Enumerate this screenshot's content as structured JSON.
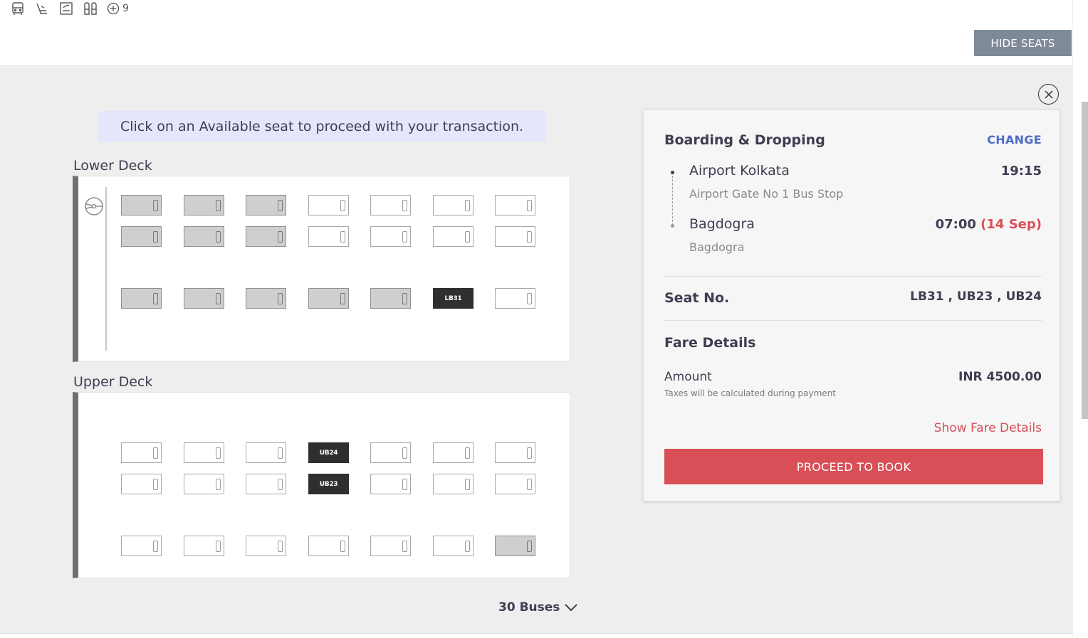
{
  "amenities": {
    "icons": [
      "bus-icon",
      "reclining-seat-icon",
      "charging-point-icon",
      "blanket-icon"
    ],
    "more_count": "9"
  },
  "hide_seats_label": "HIDE SEATS",
  "notice": "Click on an Available seat to proceed with your transaction.",
  "lower_deck": {
    "label": "Lower Deck",
    "selected_seat": "LB31"
  },
  "upper_deck": {
    "label": "Upper Deck",
    "selected_seats": [
      "UB24",
      "UB23"
    ]
  },
  "buses_count": "30 Buses",
  "summary": {
    "boarding_title": "Boarding & Dropping",
    "change_label": "CHANGE",
    "boarding": {
      "name": "Airport Kolkata",
      "sub": "Airport Gate No 1 Bus Stop",
      "time": "19:15"
    },
    "dropping": {
      "name": "Bagdogra",
      "sub": "Bagdogra",
      "time": "07:00",
      "date": "(14 Sep)"
    },
    "seat_no_label": "Seat No.",
    "seat_no_value": "LB31 , UB23 , UB24",
    "fare_title": "Fare Details",
    "amount_label": "Amount",
    "amount_value": "INR 4500.00",
    "tax_note": "Taxes will be calculated during payment",
    "show_fare_label": "Show Fare Details",
    "proceed_label": "PROCEED TO BOOK"
  },
  "colors": {
    "accent_red": "#d84f57",
    "accent_blue": "#4d6cc6",
    "notice_bg": "#e5e6fb",
    "booked_seat": "#cfcfcf",
    "selected_seat": "#2f2f2f"
  }
}
